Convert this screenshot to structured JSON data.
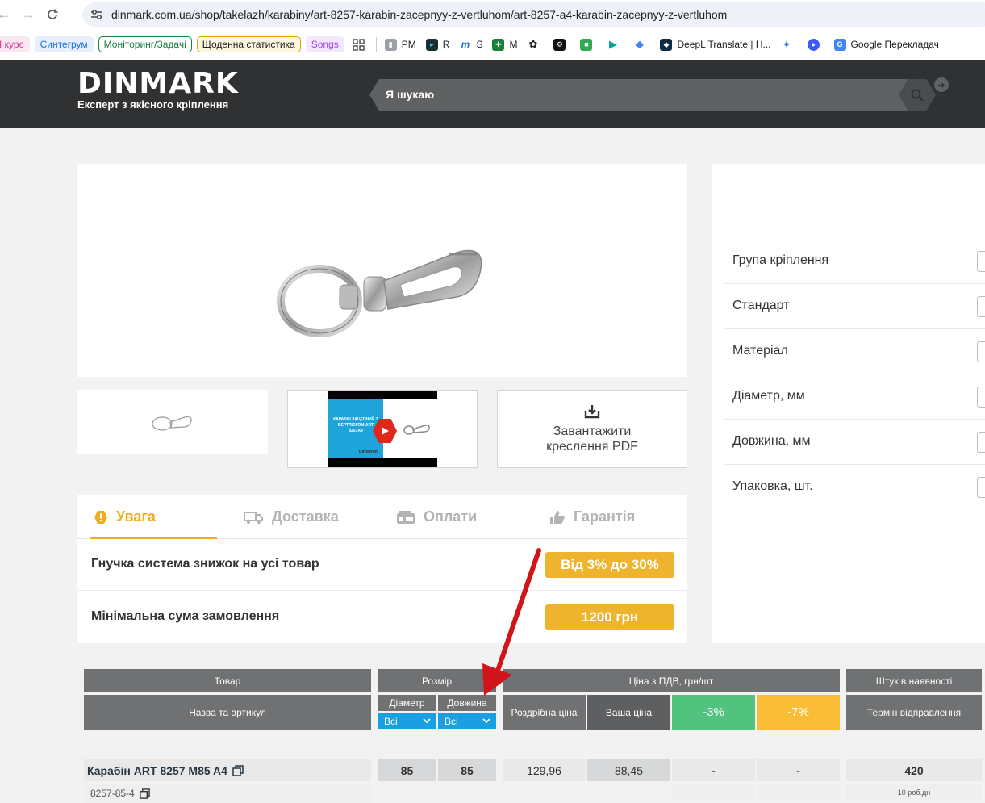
{
  "browser": {
    "url": "dinmark.com.ua/shop/takelazh/karabiny/art-8257-karabin-zacepnyy-z-vertluhom/art-8257-a4-karabin-zacepnyy-z-vertluhom",
    "bookmarks_chips": [
      {
        "label": "I курс",
        "color": "#d6338f"
      },
      {
        "label": "Синтегрум",
        "color": "#1a73e8"
      },
      {
        "label": "Моніторинг/Задачі",
        "color": "#188038"
      },
      {
        "label": "Щоденна статистика",
        "color": "#b06000"
      },
      {
        "label": "Songs",
        "color": "#a142f4"
      }
    ],
    "bookmarks": [
      {
        "label": "PM",
        "icon": "pm-icon"
      },
      {
        "label": "R",
        "icon": "r-icon"
      },
      {
        "label": "S",
        "icon": "s-icon"
      },
      {
        "label": "M",
        "icon": "m-icon"
      },
      {
        "label": "DeepL Translate | H...",
        "icon": "deepl-icon"
      },
      {
        "label": "Google Перекладач",
        "icon": "google-translate-icon"
      }
    ]
  },
  "header": {
    "logo_word": "DINMARK",
    "logo_tagline": "Експерт з якісного кріплення",
    "search_placeholder": "Я шукаю"
  },
  "gallery": {
    "video_text": "КАРАБІН ЗАЦЕПНИЙ З ВЕРТЛЮГОМ ART 8257A4",
    "video_brand": "DINMARK",
    "pdf_label_line1": "Завантажити",
    "pdf_label_line2": "креслення PDF"
  },
  "tabs": [
    {
      "label": "Увага",
      "icon": "warning-icon",
      "active": true
    },
    {
      "label": "Доставка",
      "icon": "truck-icon",
      "active": false
    },
    {
      "label": "Оплати",
      "icon": "wallet-icon",
      "active": false
    },
    {
      "label": "Гарантія",
      "icon": "thumbs-up-icon",
      "active": false
    }
  ],
  "info_rows": [
    {
      "label": "Гнучка система знижок на усі товар",
      "badge": "Від 3% до 30%"
    },
    {
      "label": "Мінімальна сума замовлення",
      "badge": "1200 грн"
    }
  ],
  "filters": [
    {
      "label": "Група кріплення"
    },
    {
      "label": "Стандарт"
    },
    {
      "label": "Матеріал"
    },
    {
      "label": "Діаметр, мм"
    },
    {
      "label": "Довжина, мм"
    },
    {
      "label": "Упаковка, шт."
    }
  ],
  "table": {
    "headers": {
      "product": "Товар",
      "size": "Розмір",
      "price": "Ціна з ПДВ, грн/шт",
      "stock": "Штук в наявності",
      "name_sku": "Назва та артикул",
      "diameter": "Діаметр",
      "length": "Довжина",
      "retail": "Роздрібна ціна",
      "your_price": "Ваша ціна",
      "disc3": "-3%",
      "disc7": "-7%",
      "ship_term": "Термін відправлення"
    },
    "selects": {
      "diameter": "Всі",
      "length": "Всі"
    },
    "rows": [
      {
        "name": "Карабін ART 8257 M85 A4",
        "sku": "8257-85-4",
        "diameter": "85",
        "length": "85",
        "retail": "129,96",
        "your_price": "88,45",
        "disc3": "-",
        "disc7": "-",
        "stock": "420",
        "disc3_sub": "-",
        "disc7_sub": "-",
        "ship_term": "10 роб.дн"
      }
    ]
  },
  "colors": {
    "accent": "#efb42e",
    "header_bg": "#2f3133",
    "select_blue": "#1a9fe0",
    "green": "#52c27f",
    "yellow": "#fbbd35",
    "arrow_red": "#d0141a"
  }
}
